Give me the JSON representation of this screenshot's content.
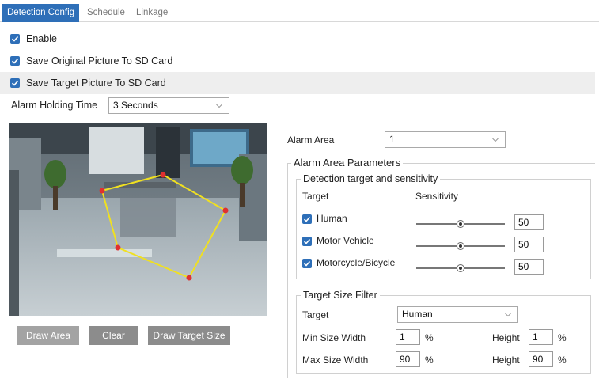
{
  "tabs": [
    {
      "label": "Detection Config",
      "active": true
    },
    {
      "label": "Schedule",
      "active": false
    },
    {
      "label": "Linkage",
      "active": false
    }
  ],
  "options": {
    "enable": {
      "label": "Enable",
      "checked": true
    },
    "save_original": {
      "label": "Save Original Picture To SD Card",
      "checked": true
    },
    "save_target": {
      "label": "Save Target Picture To SD Card",
      "checked": true
    }
  },
  "alarm_holding_time": {
    "label": "Alarm Holding Time",
    "value": "3 Seconds"
  },
  "buttons": {
    "draw_area": "Draw Area",
    "clear": "Clear",
    "draw_target_size": "Draw Target Size"
  },
  "alarm_area": {
    "label": "Alarm Area",
    "value": "1"
  },
  "alarm_area_parameters": {
    "title": "Alarm Area Parameters",
    "detection": {
      "title": "Detection target and sensitivity",
      "target_header": "Target",
      "sensitivity_header": "Sensitivity",
      "targets": [
        {
          "label": "Human",
          "checked": true,
          "sensitivity": 50
        },
        {
          "label": "Motor Vehicle",
          "checked": true,
          "sensitivity": 50
        },
        {
          "label": "Motorcycle/Bicycle",
          "checked": true,
          "sensitivity": 50
        }
      ]
    },
    "size_filter": {
      "title": "Target Size Filter",
      "target_label": "Target",
      "target_value": "Human",
      "min_width_label": "Min Size Width",
      "min_width_value": "1",
      "min_height_label": "Height",
      "min_height_value": "1",
      "max_width_label": "Max Size Width",
      "max_width_value": "90",
      "max_height_label": "Height",
      "max_height_value": "90",
      "percent": "%"
    }
  },
  "colors": {
    "accent": "#2e6fb8",
    "button": "#8c8c8c",
    "polygon": "#f0e020",
    "vertex": "#e03030"
  }
}
